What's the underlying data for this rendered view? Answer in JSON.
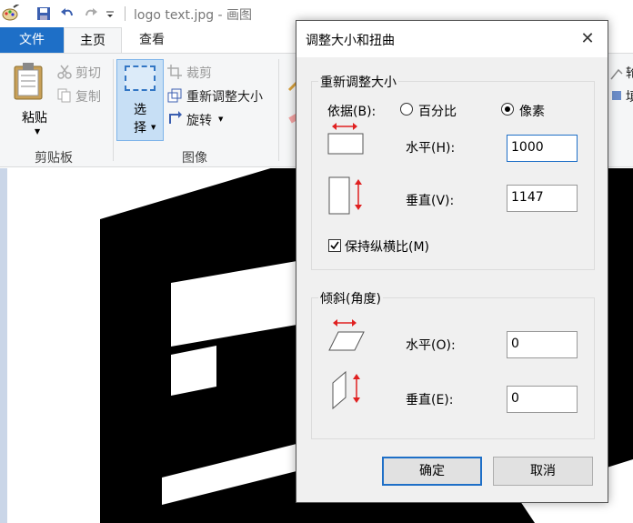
{
  "window": {
    "title": "logo text.jpg - 画图"
  },
  "tabs": {
    "file": "文件",
    "home": "主页",
    "view": "查看"
  },
  "ribbon": {
    "paste": "粘贴",
    "cut": "剪切",
    "copy": "复制",
    "clipboard_group": "剪贴板",
    "select_line1": "选",
    "select_line2": "择",
    "crop": "裁剪",
    "resize": "重新调整大小",
    "rotate": "旋转",
    "image_group": "图像",
    "partial_1": "轮",
    "partial_2": "填"
  },
  "dialog": {
    "title": "调整大小和扭曲",
    "close": "✕",
    "resize_group": "重新调整大小",
    "by_label": "依据(B):",
    "percent_label": "百分比",
    "pixels_label": "像素",
    "by_selected": "pixels",
    "h_label": "水平(H):",
    "h_value": "1000",
    "v_label": "垂直(V):",
    "v_value": "1147",
    "keep_ratio_label": "保持纵横比(M)",
    "keep_ratio": true,
    "skew_group": "倾斜(角度)",
    "skew_h_label": "水平(O):",
    "skew_h_value": "0",
    "skew_v_label": "垂直(E):",
    "skew_v_value": "0",
    "ok": "确定",
    "cancel": "取消"
  },
  "colors": {
    "accent": "#1e6fc7",
    "arrow": "#e02020",
    "select_bg": "#c7dff5"
  }
}
